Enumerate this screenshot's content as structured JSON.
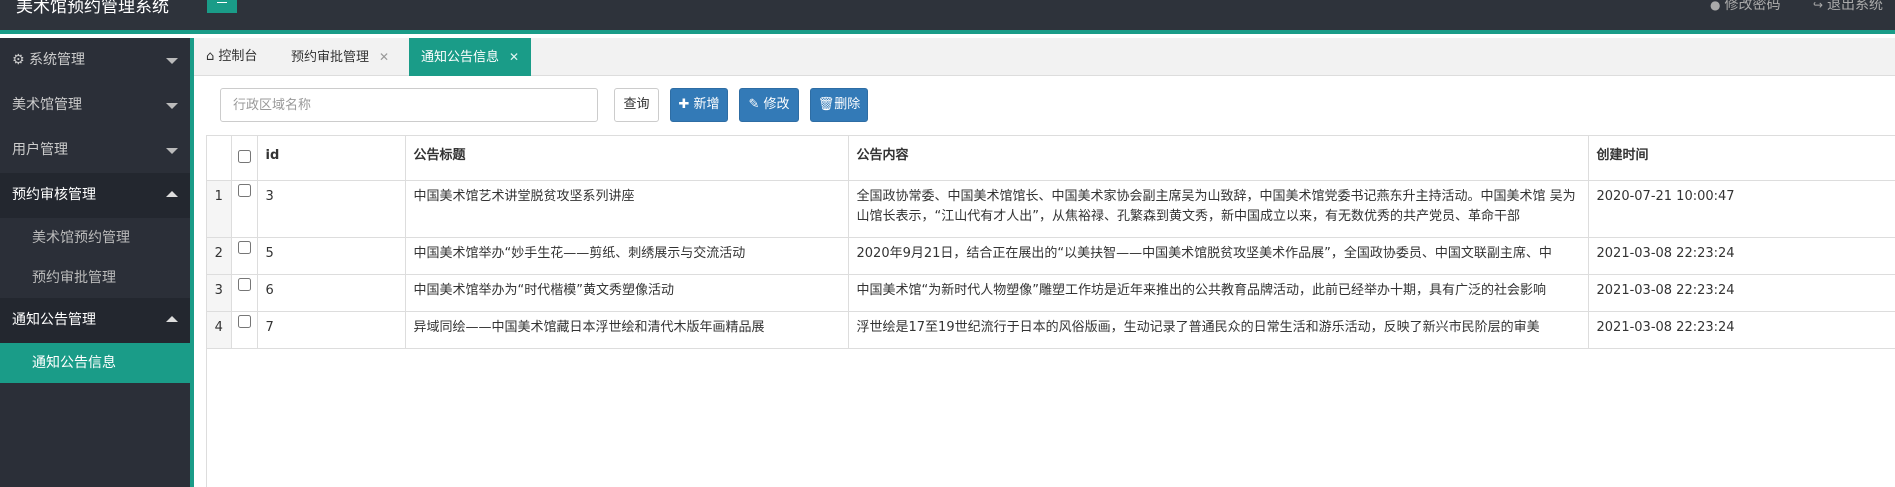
{
  "app": {
    "title": "美术馆预约管理系统"
  },
  "topbar": {
    "change_password": "修改密码",
    "logout": "退出系统"
  },
  "sidebar": {
    "items": [
      {
        "label": "系统管理",
        "icon": "gear-icon",
        "open": false
      },
      {
        "label": "美术馆管理",
        "open": false
      },
      {
        "label": "用户管理",
        "open": false
      },
      {
        "label": "预约审核管理",
        "open": true,
        "children": [
          "美术馆预约管理",
          "预约审批管理"
        ]
      },
      {
        "label": "通知公告管理",
        "open": true,
        "children": [
          "通知公告信息"
        ]
      }
    ]
  },
  "tabs": [
    {
      "label": "控制台",
      "icon": "home-icon",
      "closable": false
    },
    {
      "label": "预约审批管理",
      "closable": true
    },
    {
      "label": "通知公告信息",
      "closable": true,
      "active": true
    }
  ],
  "toolbar": {
    "search_placeholder": "行政区域名称",
    "query_label": "查询",
    "add_label": "新增",
    "edit_label": "修改",
    "delete_label": "删除"
  },
  "table": {
    "columns": [
      "id",
      "公告标题",
      "公告内容",
      "创建时间"
    ],
    "rows": [
      {
        "num": "1",
        "id": "3",
        "title": "中国美术馆艺术讲堂脱贫攻坚系列讲座",
        "content": "全国政协常委、中国美术馆馆长、中国美术家协会副主席吴为山致辞，中国美术馆党委书记燕东升主持活动。中国美术馆 吴为山馆长表示，“江山代有才人出”，从焦裕禄、孔繁森到黄文秀，新中国成立以来，有无数优秀的共产党员、革命干部",
        "created": "2020-07-21 10:00:47"
      },
      {
        "num": "2",
        "id": "5",
        "title": "中国美术馆举办“妙手生花——剪纸、刺绣展示与交流活动",
        "content": "2020年9月21日，结合正在展出的“以美扶智——中国美术馆脱贫攻坚美术作品展”，全国政协委员、中国文联副主席、中",
        "created": "2021-03-08 22:23:24"
      },
      {
        "num": "3",
        "id": "6",
        "title": "中国美术馆举办为“时代楷模”黄文秀塑像活动",
        "content": "中国美术馆“为新时代人物塑像”雕塑工作坊是近年来推出的公共教育品牌活动，此前已经举办十期，具有广泛的社会影响",
        "created": "2021-03-08 22:23:24"
      },
      {
        "num": "4",
        "id": "7",
        "title": "异域同绘——中国美术馆藏日本浮世绘和清代木版年画精品展",
        "content": "浮世绘是17至19世纪流行于日本的风俗版画，生动记录了普通民众的日常生活和游乐活动，反映了新兴市民阶层的审美",
        "created": "2021-03-08 22:23:24"
      }
    ]
  }
}
